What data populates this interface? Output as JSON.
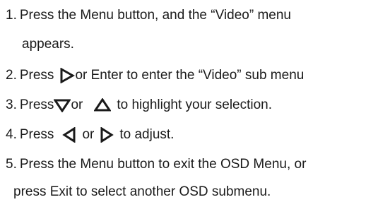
{
  "steps": [
    {
      "number": "1.",
      "text": "Press the Menu button, and the “Video” menu",
      "continuation": "appears."
    },
    {
      "number": "2.",
      "prefix": "Press",
      "icon": "triangle-right-icon",
      "suffix": "or Enter to enter the “Video” sub menu"
    },
    {
      "number": "3.",
      "prefix": "Press",
      "icon_a": "triangle-down-icon",
      "middle": "or",
      "icon_b": "triangle-up-icon",
      "suffix": "to highlight your selection."
    },
    {
      "number": "4.",
      "prefix": "Press",
      "icon_a": "triangle-left-icon",
      "middle": "or",
      "icon_b": "triangle-right-icon",
      "suffix": "to adjust."
    },
    {
      "number": "5.",
      "text": "Press the Menu button to exit the OSD Menu, or",
      "continuation": "press Exit to select another OSD submenu."
    }
  ]
}
